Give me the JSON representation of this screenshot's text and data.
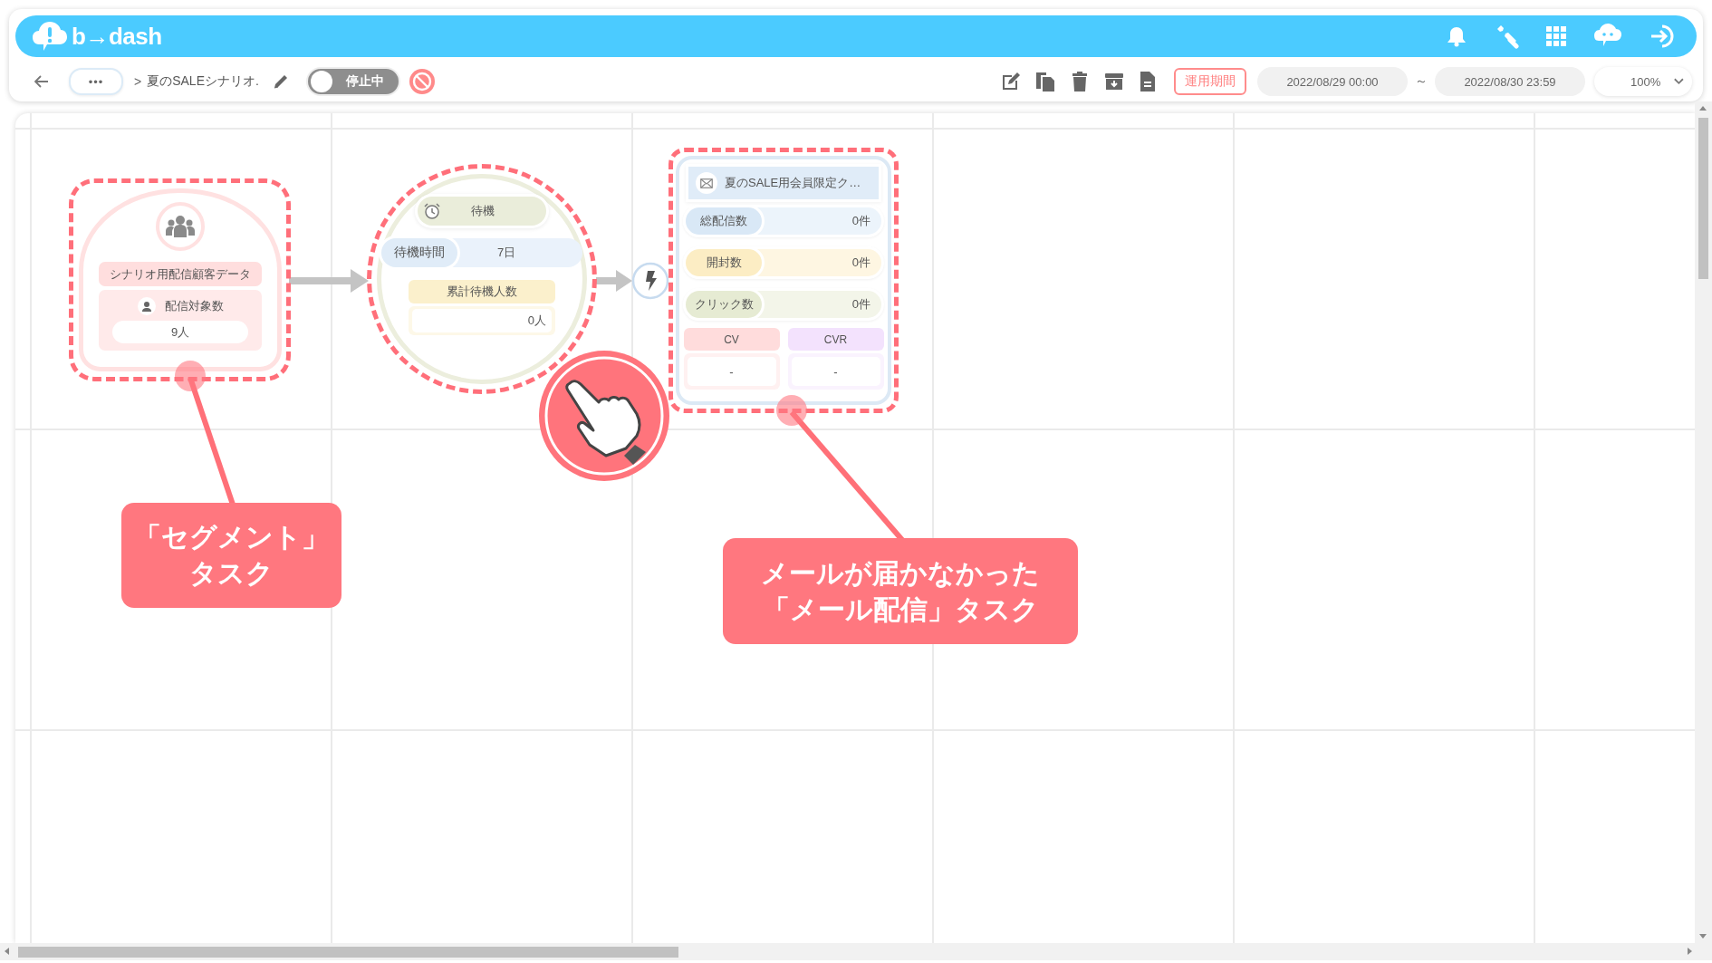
{
  "header": {
    "logo": "b→dash"
  },
  "toolbar": {
    "more": "•••",
    "separator": ">",
    "scenario_name": "夏のSALEシナリオ.",
    "status_toggle": {
      "label": "停止中",
      "on": false
    },
    "period_button": "運用期間",
    "start": "2022/08/29 00:00",
    "range_separator": "～",
    "end": "2022/08/30 23:59",
    "zoom": "100%"
  },
  "canvas": {
    "nodes": [
      {
        "kind": "segment",
        "title": "シナリオ用配信顧客データ",
        "label": "配信対象数",
        "value": "9人"
      },
      {
        "kind": "wait",
        "title": "待機",
        "time_label": "待機時間",
        "time_value": "7日",
        "count_label": "累計待機人数",
        "count_value": "0人"
      },
      {
        "kind": "mail",
        "title": "夏のSALE用会員限定ク…",
        "stats": [
          {
            "label": "総配信数",
            "value": "0件",
            "color": "#d9e8f6"
          },
          {
            "label": "開封数",
            "value": "0件",
            "color": "#fcedc4"
          },
          {
            "label": "クリック数",
            "value": "0件",
            "color": "#e6ebd3"
          }
        ],
        "rates": [
          {
            "label": "CV",
            "value": "-",
            "color": "#ffdcdc"
          },
          {
            "label": "CVR",
            "value": "-",
            "color": "#f3e2fd"
          }
        ]
      }
    ],
    "callouts": [
      {
        "text": "「セグメント」タスク"
      },
      {
        "text": "メールが届かなかった「メール配信」タスク"
      }
    ]
  }
}
